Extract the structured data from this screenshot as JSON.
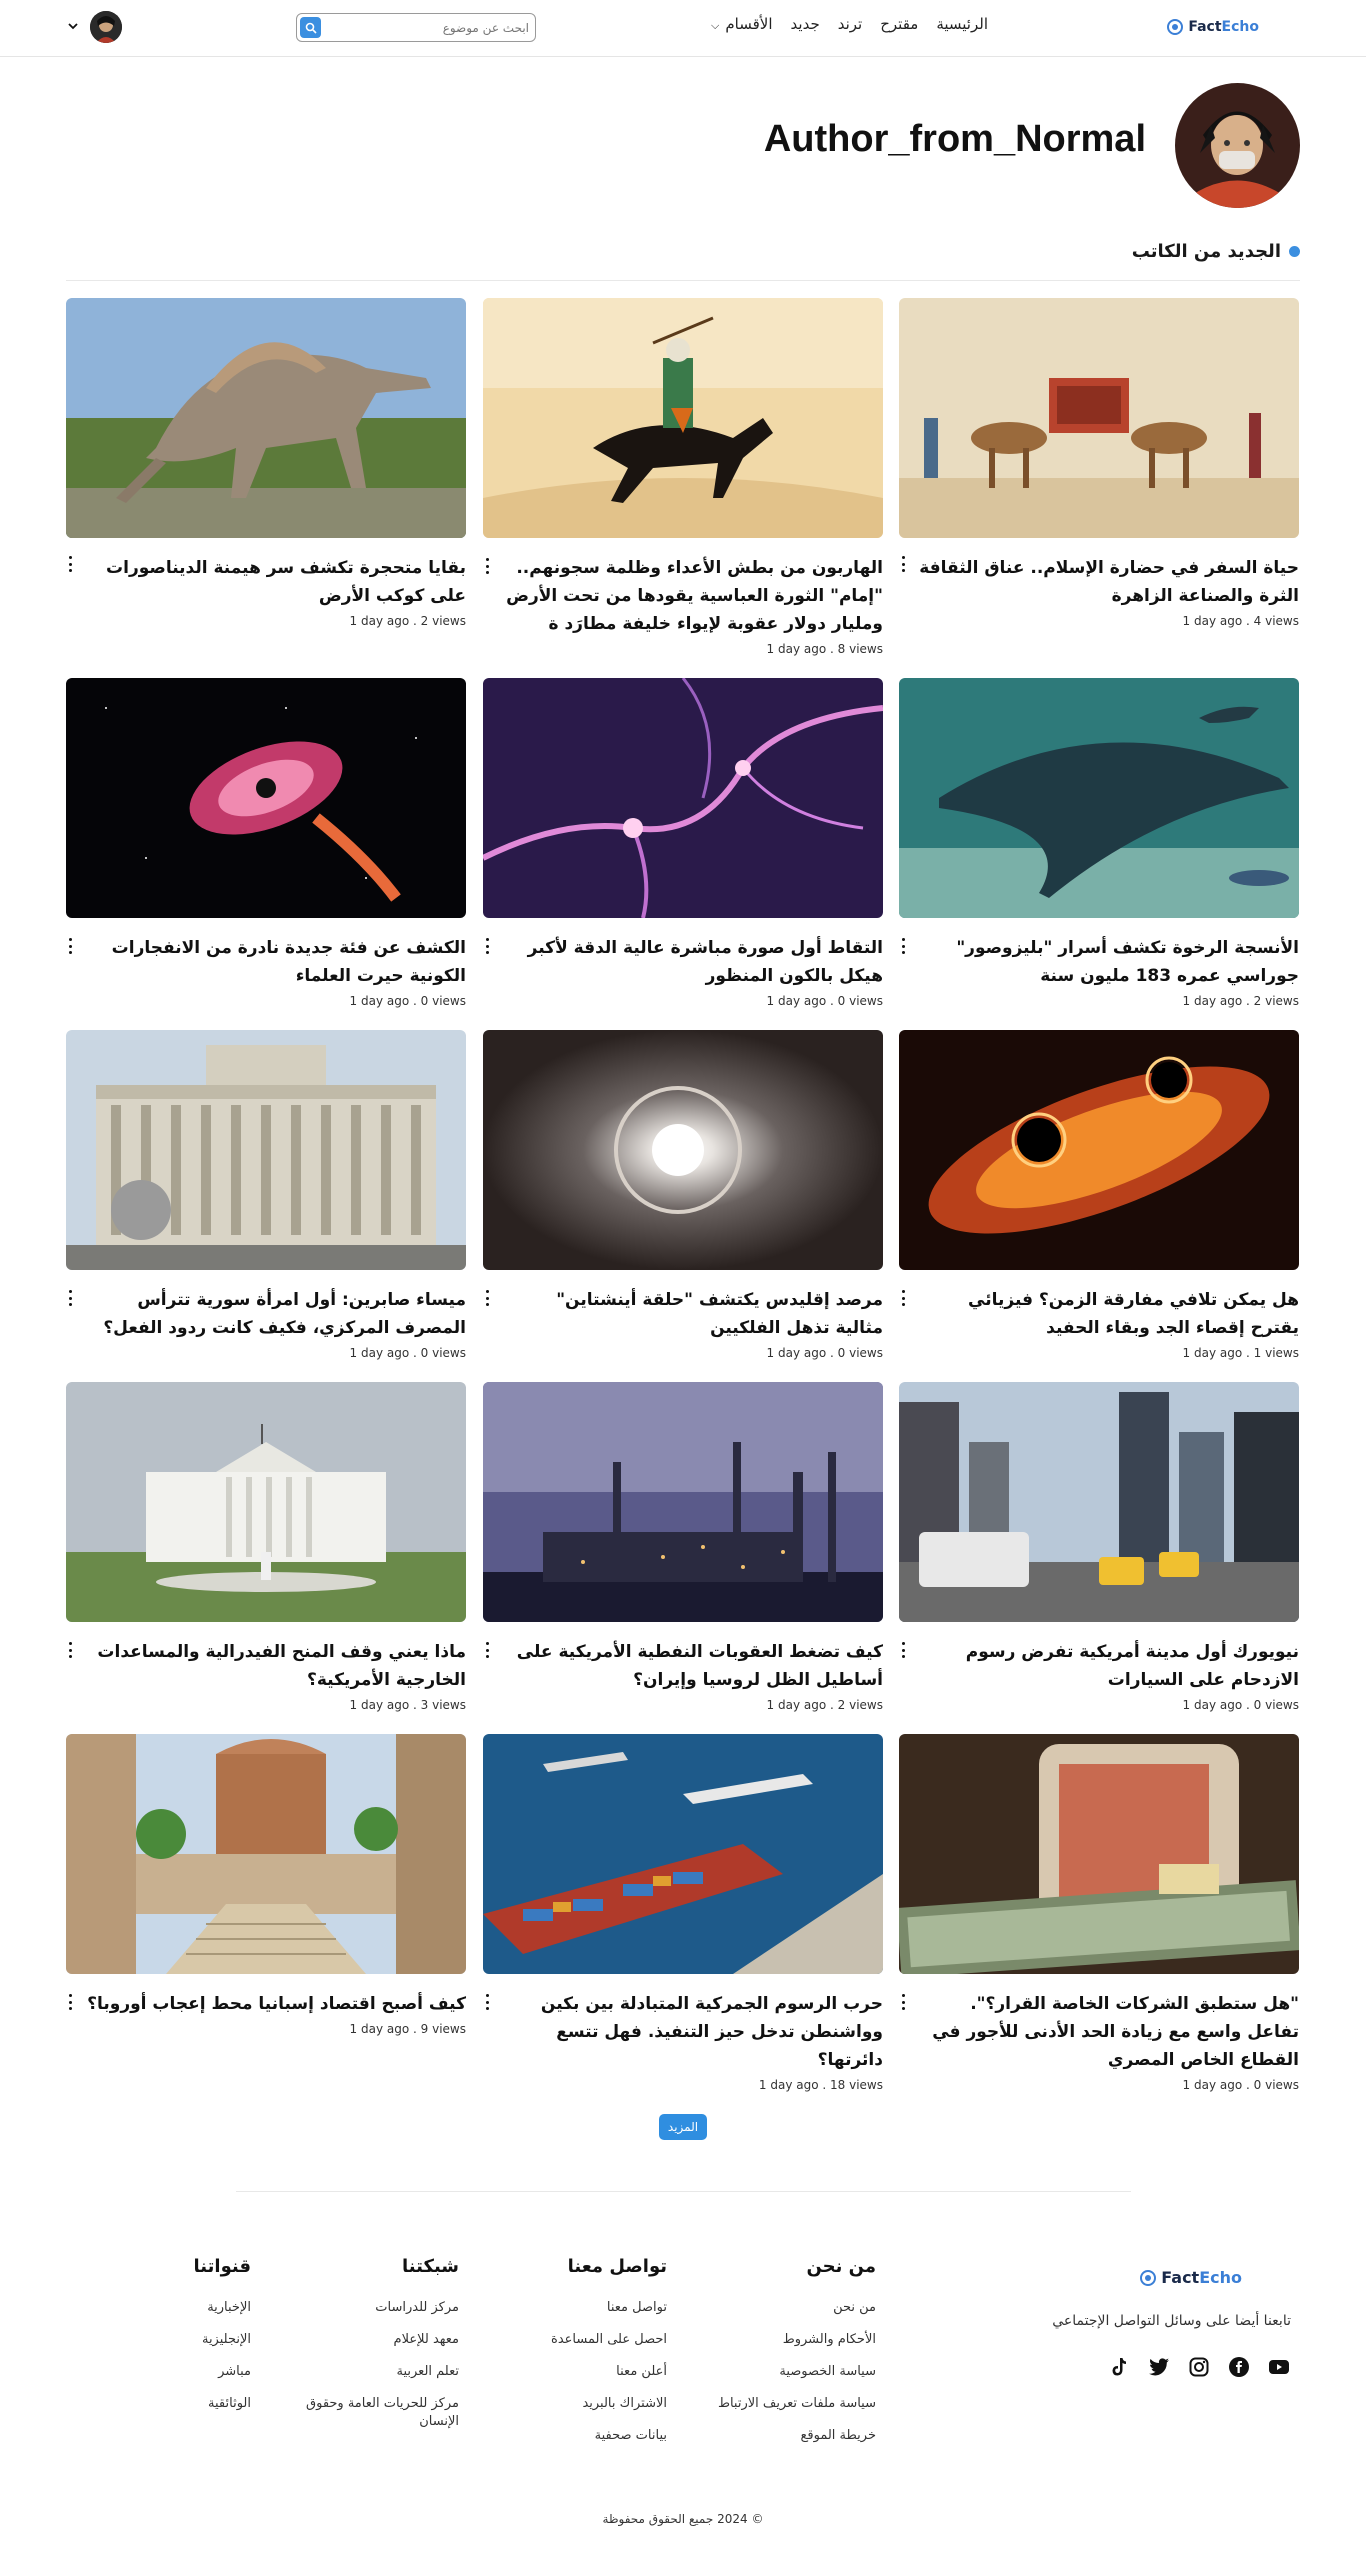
{
  "header": {
    "logo_part1": "Fact",
    "logo_part2": "Echo",
    "nav": [
      "الرئيسية",
      "مقترح",
      "ترند",
      "جديد",
      "الأقسام"
    ],
    "search_placeholder": "ابحث عن موضوع"
  },
  "author": {
    "name": "Author_from_Normal"
  },
  "section": {
    "title": "الجديد من الكاتب"
  },
  "articles": [
    {
      "title": "حياة السفر في حضارة الإسلام.. عناق الثقافة الثرة والصناعة الزاهرة",
      "time": "1 day ago",
      "views": "4 views"
    },
    {
      "title": "الهاربون من بطش الأعداء وظلمة سجونهم.. \"إمام\" الثورة العباسية يقودها من تحت الأرض ومليار دولار عقوبة لإيواء خليفة مطارَد ة",
      "time": "1 day ago",
      "views": "8 views"
    },
    {
      "title": "بقايا متحجرة تكشف سر هيمنة الديناصورات على كوكب الأرض",
      "time": "1 day ago",
      "views": "2 views"
    },
    {
      "title": "الأنسجة الرخوة تكشف أسرار \"بليزوصور\" جوراسي عمره 183 مليون سنة",
      "time": "1 day ago",
      "views": "2 views"
    },
    {
      "title": "التقاط أول صورة مباشرة عالية الدقة لأكبر هيكل بالكون المنظور",
      "time": "1 day ago",
      "views": "0 views"
    },
    {
      "title": "الكشف عن فئة جديدة نادرة من الانفجارات الكونية حيرت العلماء",
      "time": "1 day ago",
      "views": "0 views"
    },
    {
      "title": "هل يمكن تلافي مفارقة الزمن؟ فيزيائي يقترح إقصاء الجد وبقاء الحفيد",
      "time": "1 day ago",
      "views": "1 views"
    },
    {
      "title": "مرصد إقليدس يكتشف \"حلقة أينشتاين\" مثالية تذهل الفلكيين",
      "time": "1 day ago",
      "views": "0 views"
    },
    {
      "title": "ميساء صابرين: أول امرأة سورية تترأس المصرف المركزي، فكيف كانت ردود الفعل؟",
      "time": "1 day ago",
      "views": "0 views"
    },
    {
      "title": "نيويورك أول مدينة أمريكية تفرض رسوم الازدحام على السيارات",
      "time": "1 day ago",
      "views": "0 views"
    },
    {
      "title": "كيف تضغط العقوبات النفطية الأمريكية على أساطيل الظل لروسيا وإيران؟",
      "time": "1 day ago",
      "views": "2 views"
    },
    {
      "title": "ماذا يعني وقف المنح الفيدرالية والمساعدات الخارجية الأمريكية؟",
      "time": "1 day ago",
      "views": "3 views"
    },
    {
      "title": "\"هل ستطبق الشركات الخاصة القرار؟\". تفاعل واسع مع زيادة الحد الأدنى للأجور في القطاع الخاص المصري",
      "time": "1 day ago",
      "views": "0 views"
    },
    {
      "title": "حرب الرسوم الجمركية المتبادلة بين بكين وواشنطن تدخل حيز التنفيذ. فهل تتسع دائرتها؟",
      "time": "1 day ago",
      "views": "18 views"
    },
    {
      "title": "كيف أصبح اقتصاد إسبانيا محط إعجاب أوروبا؟",
      "time": "1 day ago",
      "views": "9 views"
    }
  ],
  "more_button": "المزيد",
  "footer": {
    "tagline": "تابعنا أيضا على وسائل التواصل الإجتماعي",
    "social_icons": [
      "youtube-icon",
      "facebook-icon",
      "instagram-icon",
      "twitter-icon",
      "tiktok-icon"
    ],
    "about": {
      "title": "من نحن",
      "links": [
        "من نحن",
        "الأحكام والشروط",
        "سياسة الخصوصية",
        "سياسة ملفات تعريف الارتباط",
        "خريطة الموقع"
      ]
    },
    "contact": {
      "title": "تواصل معنا",
      "links": [
        "تواصل معنا",
        "احصل على المساعدة",
        "أعلن معنا",
        "الاشتراك بالبريد",
        "بيانات صحفية"
      ]
    },
    "network": {
      "title": "شبكتنا",
      "links": [
        "مركز للدراسات",
        "معهد للإعلام",
        "تعلم العربية",
        "مركز للحريات العامة وحقوق الإنسان"
      ]
    },
    "channels": {
      "title": "قنواتنا",
      "links": [
        "الإخبارية",
        "الإنجليزية",
        "مباشر",
        "الوثائقية"
      ]
    },
    "copyright": "© 2024 جميع الحقوق محفوظة"
  },
  "colors": {
    "accent": "#3b8fe0",
    "logo_echo": "#3b7fd6"
  }
}
